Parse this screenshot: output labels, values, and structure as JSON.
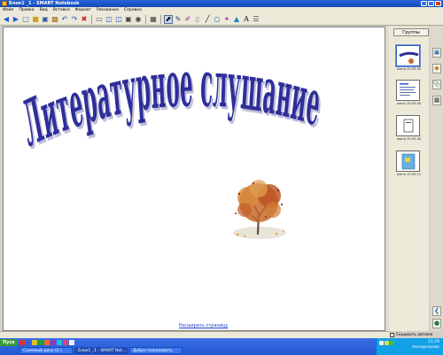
{
  "window": {
    "title": "Блок1 _1 - SMART Notebook"
  },
  "menu": [
    "Файл",
    "Правка",
    "Вид",
    "Вставка",
    "Формат",
    "Рисование",
    "Справка"
  ],
  "toolbar": {
    "icons": [
      "back-icon",
      "forward-icon",
      "new-page-icon",
      "open-icon",
      "save-icon",
      "paste-icon",
      "undo-icon",
      "redo-icon",
      "delete-icon",
      "screen-shade-icon",
      "full-screen-icon",
      "dual-page-icon",
      "capture-icon",
      "document-camera-icon",
      "table-icon",
      "select-icon",
      "pen-icon",
      "creative-pen-icon",
      "eraser-icon",
      "line-icon",
      "shape-icon",
      "magic-pen-icon",
      "fill-icon",
      "text-icon",
      "properties-icon"
    ]
  },
  "canvas": {
    "headline": "Литературное слушание",
    "headline_color": "#2e2e9a",
    "extend_page_link": "Расширить страницу"
  },
  "sidebar": {
    "groups_button": "Группы",
    "thumbnails": [
      {
        "label": "июня 15:05:40"
      },
      {
        "label": "июня 15:05:40"
      },
      {
        "label": "июня 15:05:40"
      },
      {
        "label": "июня 15:05:12"
      }
    ],
    "auto_hide_label": "Скрывать автома"
  },
  "taskbar": {
    "start_label": "Пуск",
    "tasks": [
      "Съемный диск (E:)",
      "Блок1 _1 - SMART Not...",
      "Добро пожаловать"
    ],
    "clock_time": "21:29",
    "clock_day": "понедельник"
  }
}
